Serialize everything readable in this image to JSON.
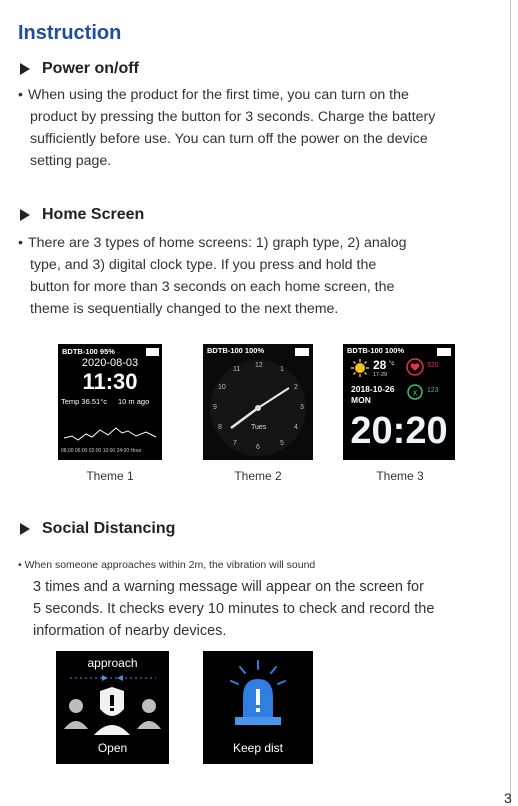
{
  "title": "Instruction",
  "sections": [
    {
      "heading": "Power on/off",
      "bullet": "•",
      "line1": "When using the product for the first time, you can turn on the",
      "line2": "product by pressing the button for 3 seconds. Charge the battery",
      "line3": "sufficiently before use. You can turn off the power on the device",
      "line4": "setting page."
    },
    {
      "heading": "Home Screen",
      "bullet": "•",
      "line1": "There are 3 types of home screens: 1) graph type, 2) analog",
      "line2": "type, and 3) digital clock type. If you press and hold the",
      "line3": "button for more than 3 seconds on each home screen, the",
      "line4": "theme is sequentially changed to the next theme."
    },
    {
      "heading": "Social Distancing",
      "bullet": "•",
      "line1": "When someone approaches within 2m, the vibration will sound",
      "line2": "3 times and a warning message will appear on the screen for",
      "line3": "5 seconds. It checks every 10 minutes to check and record the",
      "line4": "information of nearby devices."
    }
  ],
  "themes": [
    {
      "caption": "Theme 1",
      "status": "BDTB-100  95%",
      "date": "2020-08-03",
      "time": "11:30",
      "temp": "Temp 36.51°c",
      "range": "10 m ago",
      "axis": "08:00 06:00 02:00 10:00 24:00 Hour"
    },
    {
      "caption": "Theme 2",
      "status": "BDTB-100 100%",
      "dial_numbers": [
        "11",
        "12",
        "1",
        "10",
        "2",
        "9",
        "3",
        "8",
        "4",
        "7",
        "6",
        "5"
      ],
      "day": "Tues"
    },
    {
      "caption": "Theme 3",
      "status": "BDTB-100 100%",
      "temp": "28",
      "temp_unit": "°c",
      "temp_sub": "17-29",
      "heart": "320",
      "date": "2018-10-26",
      "weekday": "MON",
      "steps": "123",
      "time": "20:20"
    }
  ],
  "alerts": [
    {
      "top_label": "approach",
      "bottom_label": "Open"
    },
    {
      "bottom_label": "Keep dist"
    }
  ],
  "page_number": "3"
}
